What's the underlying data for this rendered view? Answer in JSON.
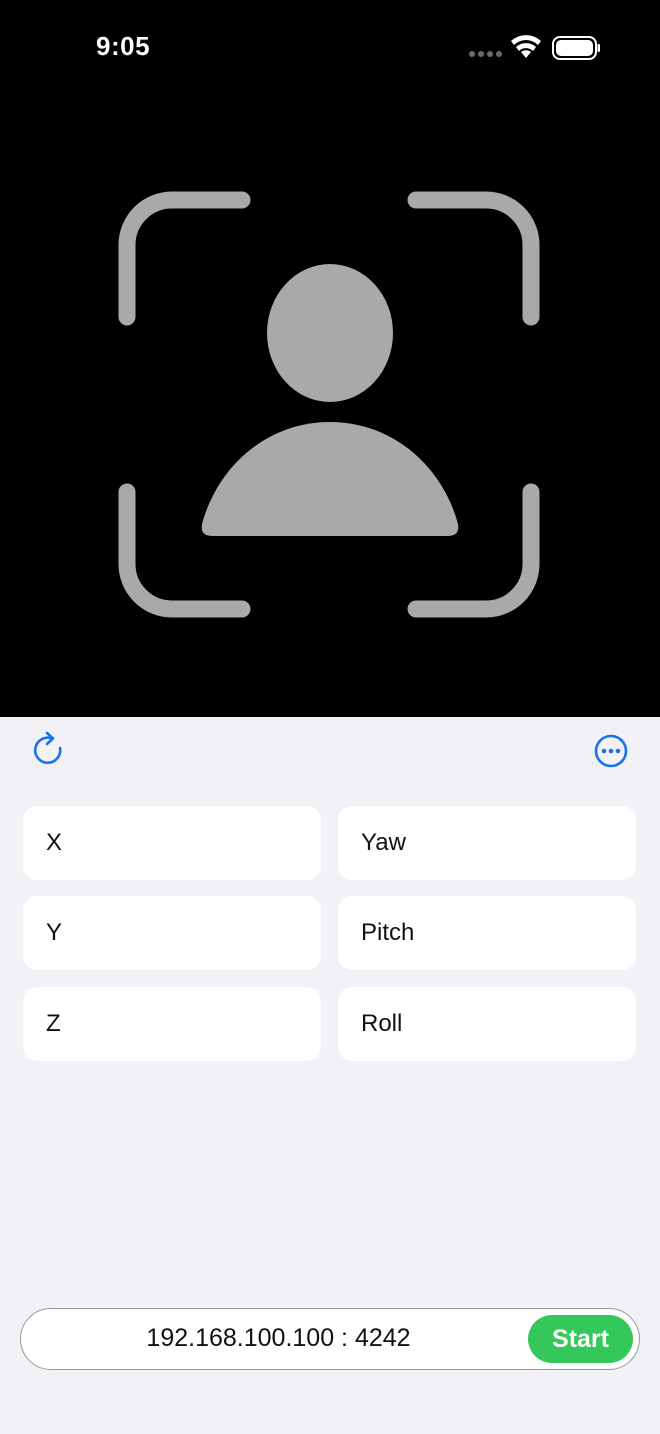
{
  "status_bar": {
    "time": "9:05"
  },
  "toolbar": {
    "refresh_icon": "arrow-clockwise-icon",
    "more_icon": "ellipsis-circle-icon"
  },
  "values": [
    {
      "label": "X"
    },
    {
      "label": "Yaw"
    },
    {
      "label": "Y"
    },
    {
      "label": "Pitch"
    },
    {
      "label": "Z"
    },
    {
      "label": "Roll"
    }
  ],
  "connection": {
    "address": "192.168.100.100 : 4242",
    "start_label": "Start"
  },
  "colors": {
    "accent": "#1a73e8",
    "start": "#34c759",
    "camera_bg": "#000000",
    "face_icon": "#a9a9a9"
  }
}
